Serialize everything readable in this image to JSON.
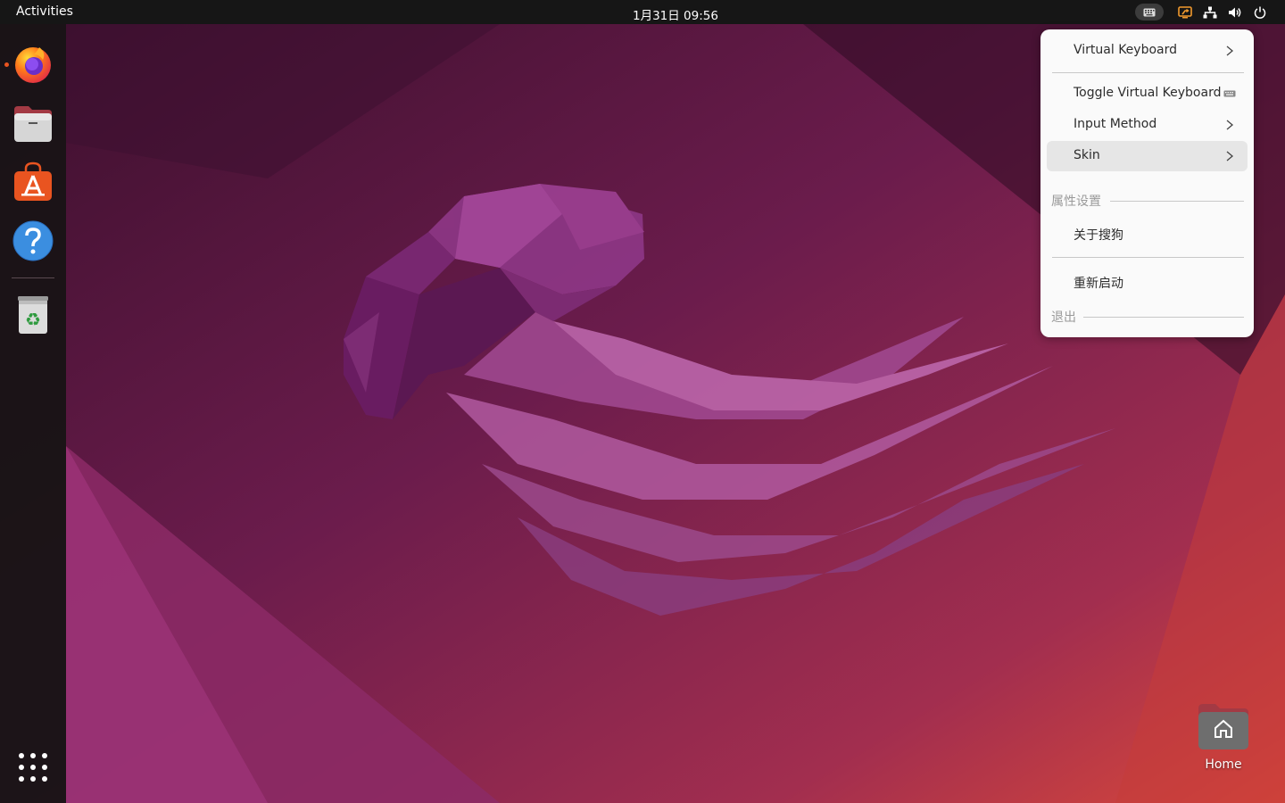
{
  "topbar": {
    "activities_label": "Activities",
    "clock": "1月31日  09:56",
    "tray_icons": [
      "keyboard-icon",
      "screen-share-icon",
      "network-icon",
      "volume-icon",
      "power-icon"
    ]
  },
  "dock": {
    "items": [
      {
        "name": "firefox",
        "icon": "firefox-icon",
        "running": true
      },
      {
        "name": "files",
        "icon": "files-icon",
        "running": false
      },
      {
        "name": "app-center",
        "icon": "app-center-icon",
        "running": false
      },
      {
        "name": "help",
        "icon": "help-icon",
        "running": false
      },
      {
        "name": "trash",
        "icon": "trash-icon",
        "running": false
      }
    ],
    "show_apps_icon": "app-grid-icon"
  },
  "menu": {
    "items": [
      {
        "label": "Virtual Keyboard",
        "submenu": true
      },
      {
        "label": "Toggle Virtual Keyboard",
        "icon": "keyboard-icon"
      },
      {
        "label": "Input Method",
        "submenu": true
      },
      {
        "label": "Skin",
        "submenu": true,
        "highlighted": true
      },
      {
        "label": "关于搜狗"
      },
      {
        "label": "重新启动"
      }
    ],
    "sections": [
      "属性设置",
      "退出"
    ]
  },
  "desktop": {
    "home_label": "Home"
  },
  "colors": {
    "topbar": "#161616",
    "dock": "#191416",
    "accent": "#e95420",
    "menu_bg": "#fafafa"
  }
}
